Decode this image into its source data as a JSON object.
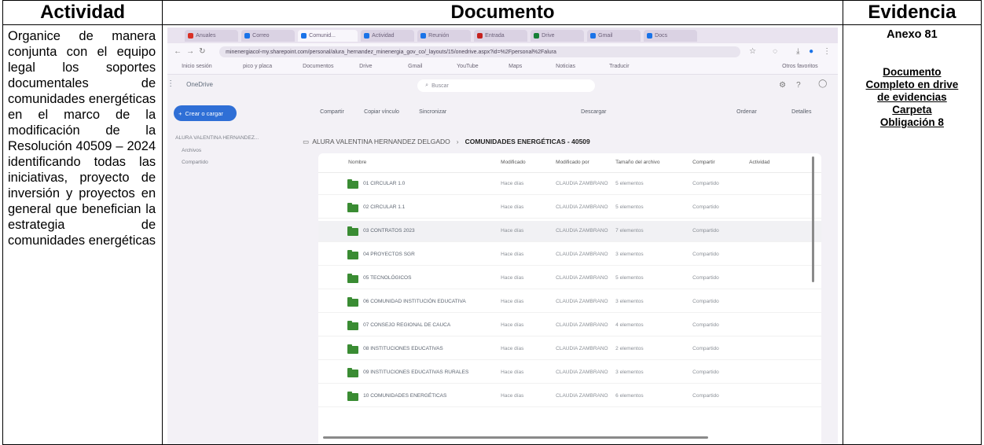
{
  "table": {
    "headers": {
      "activity": "Actividad",
      "document": "Documento",
      "evidence": "Evidencia"
    },
    "activity_text": "Organice de manera conjunta con el equipo legal los soportes documentales de comunidades energéticas en el marco de la modificación de la Resolución 40509 – 2024 identificando todas las iniciativas, proyecto de inversión y proyectos en general que benefician la estrategia de comunidades energéticas",
    "evidence": {
      "annex": "Anexo 81",
      "link_lines": [
        "Documento",
        "Completo en drive",
        "de evidencias",
        "Carpeta",
        "Obligación 8"
      ]
    }
  },
  "screenshot": {
    "tabs": [
      {
        "label": "Anuales",
        "color": "#d93025"
      },
      {
        "label": "Correo",
        "color": "#1a73e8"
      },
      {
        "label": "Comunid...",
        "color": "#1a73e8",
        "active": true
      },
      {
        "label": "Actividad",
        "color": "#1a73e8"
      },
      {
        "label": "Reunión",
        "color": "#1a73e8"
      },
      {
        "label": "Entrada",
        "color": "#c5221f"
      },
      {
        "label": "Drive",
        "color": "#188038"
      },
      {
        "label": "Gmail",
        "color": "#1a73e8"
      },
      {
        "label": "Docs",
        "color": "#1a73e8"
      }
    ],
    "url": "minenergiacol-my.sharepoint.com/personal/alura_hernandez_minenergia_gov_co/_layouts/15/onedrive.aspx?id=%2Fpersonal%2Falura",
    "bookmarks": [
      "Inicio sesión",
      "pico y placa",
      "Documentos",
      "Drive",
      "Gmail",
      "YouTube",
      "Maps",
      "Noticias",
      "Traducir",
      "Otros favoritos"
    ],
    "app_title": "OneDrive",
    "search_placeholder": "Buscar",
    "create_button": "Crear o cargar",
    "left_items": [
      "ALURA VALENTINA HERNANDEZ...",
      "Archivos",
      "Compartido"
    ],
    "commands": [
      "Compartir",
      "Copiar vínculo",
      "Sincronizar",
      "Descargar",
      "Ordenar",
      "Detalles"
    ],
    "breadcrumb": [
      "ALURA VALENTINA HERNANDEZ DELGADO",
      "COMUNIDADES ENERGÉTICAS - 40509"
    ],
    "columns": [
      "Nombre",
      "Modificado",
      "Modificado por",
      "Tamaño del archivo",
      "Compartir",
      "Actividad"
    ],
    "rows": [
      {
        "name": "01 CIRCULAR 1.0",
        "modified": "Hace días",
        "by": "CLAUDIA ZAMBRANO",
        "size": "5 elementos",
        "share": "Compartido"
      },
      {
        "name": "02 CIRCULAR 1.1",
        "modified": "Hace días",
        "by": "CLAUDIA ZAMBRANO",
        "size": "5 elementos",
        "share": "Compartido"
      },
      {
        "name": "03 CONTRATOS 2023",
        "modified": "Hace días",
        "by": "CLAUDIA ZAMBRANO",
        "size": "7 elementos",
        "share": "Compartido",
        "selected": true
      },
      {
        "name": "04 PROYECTOS SGR",
        "modified": "Hace días",
        "by": "CLAUDIA ZAMBRANO",
        "size": "3 elementos",
        "share": "Compartido"
      },
      {
        "name": "05 TECNOLÓGICOS",
        "modified": "Hace días",
        "by": "CLAUDIA ZAMBRANO",
        "size": "5 elementos",
        "share": "Compartido"
      },
      {
        "name": "06 COMUNIDAD INSTITUCIÓN EDUCATIVA",
        "modified": "Hace días",
        "by": "CLAUDIA ZAMBRANO",
        "size": "3 elementos",
        "share": "Compartido"
      },
      {
        "name": "07 CONSEJO REGIONAL DE CAUCA",
        "modified": "Hace días",
        "by": "CLAUDIA ZAMBRANO",
        "size": "4 elementos",
        "share": "Compartido"
      },
      {
        "name": "08 INSTITUCIONES EDUCATIVAS",
        "modified": "Hace días",
        "by": "CLAUDIA ZAMBRANO",
        "size": "2 elementos",
        "share": "Compartido"
      },
      {
        "name": "09 INSTITUCIONES EDUCATIVAS RURALES",
        "modified": "Hace días",
        "by": "CLAUDIA ZAMBRANO",
        "size": "3 elementos",
        "share": "Compartido"
      },
      {
        "name": "10 COMUNIDADES ENERGÉTICAS",
        "modified": "Hace días",
        "by": "CLAUDIA ZAMBRANO",
        "size": "6 elementos",
        "share": "Compartido"
      }
    ]
  }
}
